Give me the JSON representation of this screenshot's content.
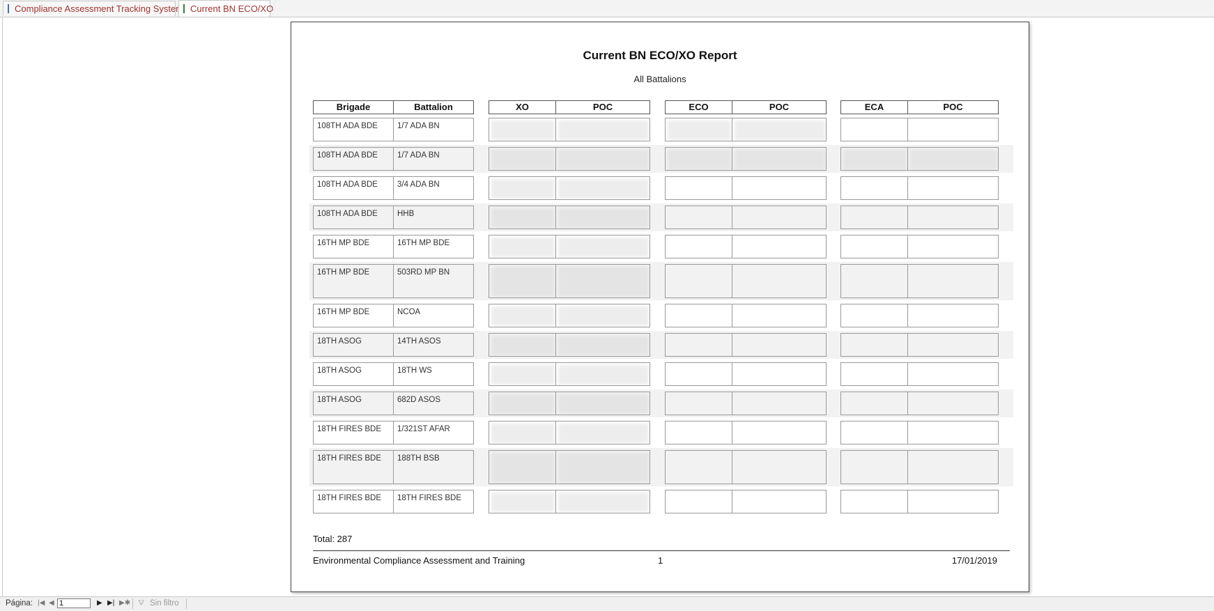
{
  "tabs": [
    {
      "label": "Compliance Assessment Tracking System",
      "icon": "form-icon"
    },
    {
      "label": "Current BN ECO/XO",
      "icon": "report-icon",
      "active": true
    }
  ],
  "report": {
    "title": "Current BN ECO/XO Report",
    "subtitle": "All Battalions",
    "headers": [
      "Brigade",
      "Battalion",
      "XO",
      "POC",
      "ECO",
      "POC",
      "ECA",
      "POC"
    ],
    "rows": [
      {
        "brigade": "108TH ADA BDE",
        "battalion": "1/7 ADA BN"
      },
      {
        "brigade": "108TH ADA BDE",
        "battalion": "1/7 ADA BN"
      },
      {
        "brigade": "108TH ADA BDE",
        "battalion": "3/4 ADA BN"
      },
      {
        "brigade": "108TH ADA BDE",
        "battalion": "HHB"
      },
      {
        "brigade": "16TH MP BDE",
        "battalion": "16TH MP BDE"
      },
      {
        "brigade": "16TH MP BDE",
        "battalion": "503RD MP BN"
      },
      {
        "brigade": "16TH MP BDE",
        "battalion": "NCOA"
      },
      {
        "brigade": "18TH ASOG",
        "battalion": "14TH ASOS"
      },
      {
        "brigade": "18TH ASOG",
        "battalion": "18TH WS"
      },
      {
        "brigade": "18TH ASOG",
        "battalion": "682D ASOS"
      },
      {
        "brigade": "18TH FIRES BDE",
        "battalion": "1/321ST AFAR"
      },
      {
        "brigade": "18TH FIRES BDE",
        "battalion": "188TH BSB"
      },
      {
        "brigade": "18TH FIRES BDE",
        "battalion": "18TH FIRES BDE"
      }
    ],
    "total": "Total: 287",
    "footer_left": "Environmental Compliance Assessment and Training",
    "footer_center": "1",
    "footer_right": "17/01/2019"
  },
  "statusbar": {
    "page_label": "Página:",
    "page_value": "1",
    "filter_label": "Sin filtro"
  }
}
